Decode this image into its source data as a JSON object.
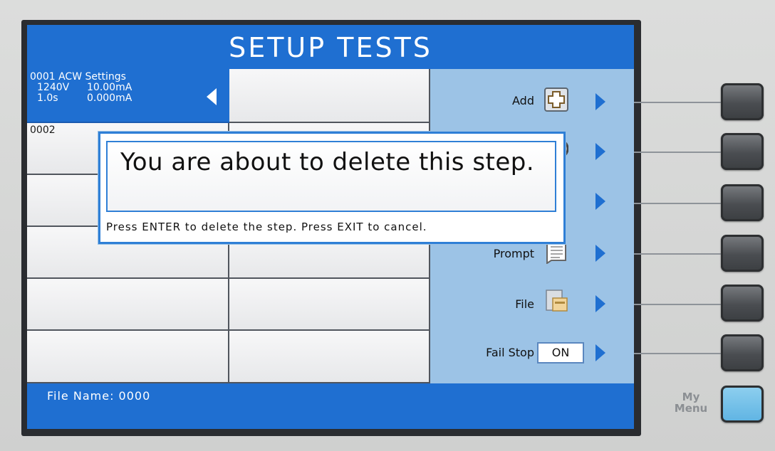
{
  "title": "SETUP TESTS",
  "steps": [
    {
      "number": "0001",
      "type": "ACW",
      "label": "Settings",
      "voltage": "1240V",
      "current_hi": "10.00mA",
      "time": "1.0s",
      "current_lo": "0.000mA",
      "selected": true
    },
    {
      "number": "0002",
      "selected": false
    }
  ],
  "side_menu": {
    "items": [
      {
        "label": "Add",
        "icon": "add-plus-icon"
      },
      {
        "label": "",
        "icon": "delete-icon"
      },
      {
        "label": "",
        "icon": "copy-icon"
      },
      {
        "label": "Prompt",
        "icon": "prompt-document-icon"
      },
      {
        "label": "File",
        "icon": "file-cabinet-icon"
      },
      {
        "label": "Fail Stop",
        "value": "ON"
      }
    ]
  },
  "status_bar": {
    "file_name": "File Name: 0000"
  },
  "dialog": {
    "message": "You are about to delete this step.",
    "hint": "Press ENTER to delete the step.  Press EXIT to cancel."
  },
  "hardware": {
    "my_menu_label": "My Menu"
  },
  "colors": {
    "accent_blue": "#1f6fd1",
    "side_panel": "#9cc3e6",
    "my_menu_button": "#5eb3e3"
  }
}
